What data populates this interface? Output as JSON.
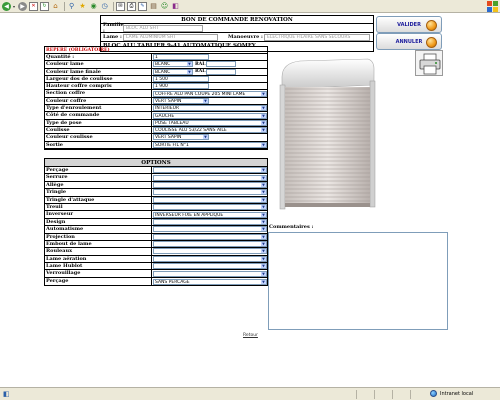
{
  "toolbar": {
    "icons": [
      "back-icon",
      "forward-icon",
      "stop-icon",
      "refresh-icon",
      "home-icon",
      "search-icon",
      "favorites-icon",
      "media-icon",
      "history-icon",
      "mail-icon",
      "print-icon",
      "edit-icon",
      "discuss-icon",
      "messenger-icon",
      "research-icon"
    ]
  },
  "header": {
    "title": "BON DE COMMANDE RENOVATION",
    "famille_label": "Famille :",
    "famille_value": "BLOC ALU SHT",
    "lame_label": "Lame :",
    "lame_value": "LAME ALUMINIUM SHT",
    "manoeuvre_label": "Manoeuvre :",
    "manoeuvre_value": "ELECTRIQUE FILAIRE SANS SECOURS",
    "product": "BLOC ALU TABLIER 9-41 AUTOMATIQUE SOMFY"
  },
  "buttons": {
    "valider": "VALIDER",
    "annuler": "ANNULER"
  },
  "form": {
    "required_note": "REPERE (OBLIGATOIRE)",
    "rows": [
      {
        "label": "Quantité :",
        "value": "1",
        "type": "input"
      },
      {
        "label": "Couleur lame",
        "value": "BLANC",
        "type": "select_ral",
        "ral_label": "RAL"
      },
      {
        "label": "Couleur lame finale",
        "value": "BLANC",
        "type": "select_ral",
        "ral_label": "RAL"
      },
      {
        "label": "Largeur dos de coulisse",
        "value": "1 500",
        "type": "input"
      },
      {
        "label": "Hauteur coffre compris",
        "value": "1 900",
        "type": "input"
      },
      {
        "label": "Section coffre",
        "value": "COFFRE ALU PAN COUPE 205 MINI LAME",
        "type": "select"
      },
      {
        "label": "Couleur coffre",
        "value": "VERT SAPIN",
        "type": "select_short"
      },
      {
        "label": "Type d'enroulement",
        "value": "INTERIEUR",
        "type": "select"
      },
      {
        "label": "Côté de commande",
        "value": "GAUCHE",
        "type": "select"
      },
      {
        "label": "Type de pose",
        "value": "POSE TABLEAU",
        "type": "select"
      },
      {
        "label": "Coulisse",
        "value": "COULISSE ALU 53/22 SANS AILE",
        "type": "select"
      },
      {
        "label": "Couleur coulisse",
        "value": "VERT SAPIN",
        "type": "select_short"
      },
      {
        "label": "Sortie",
        "value": "SORTIE FIL N°1",
        "type": "select"
      }
    ]
  },
  "options": {
    "title": "OPTIONS",
    "rows": [
      {
        "label": "Perçage",
        "value": ""
      },
      {
        "label": "Serrure",
        "value": ""
      },
      {
        "label": "Allège",
        "value": ""
      },
      {
        "label": "Tringle",
        "value": ""
      },
      {
        "label": "Tringle d'attaque",
        "value": ""
      },
      {
        "label": "Treuil",
        "value": ""
      },
      {
        "label": "Inverseur",
        "value": "INVERSEUR FIXE EN APPLIQUE"
      },
      {
        "label": "Design",
        "value": ""
      },
      {
        "label": "Automatisme",
        "value": ""
      },
      {
        "label": "Projection",
        "value": ""
      },
      {
        "label": "Embout de lame",
        "value": ""
      },
      {
        "label": "Rouleaux",
        "value": ""
      },
      {
        "label": "Lame aération",
        "value": ""
      },
      {
        "label": "Lame Hublot",
        "value": ""
      },
      {
        "label": "Verrouillage",
        "value": ""
      },
      {
        "label": "Perçage",
        "value": "SANS PERCAGE"
      }
    ]
  },
  "comments": {
    "label": "Commentaires :",
    "value": ""
  },
  "footer": {
    "retour": "Retour"
  },
  "statusbar": {
    "zone": "Intranet local"
  }
}
